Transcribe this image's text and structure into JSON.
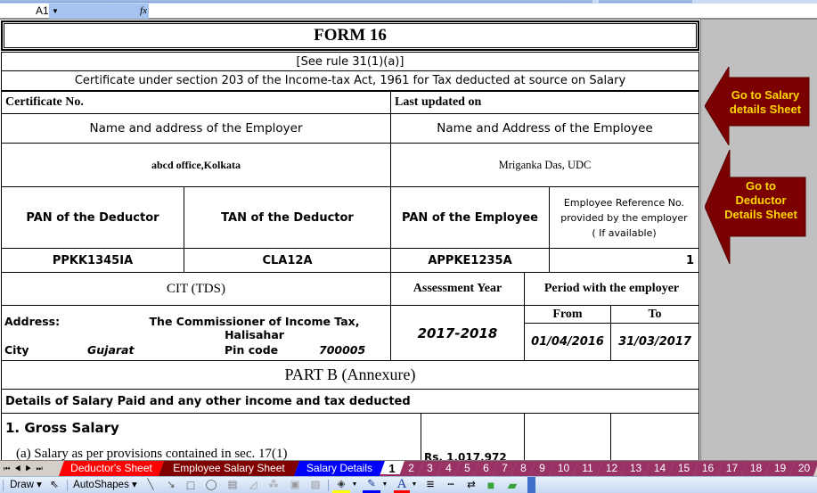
{
  "formula_bar": {
    "name_box": "A1",
    "dropdown_icon": "▼",
    "fx_label": "fx",
    "formula": ""
  },
  "form": {
    "title": "FORM 16",
    "rule": "[See rule 31(1)(a)]",
    "certificate_caption": "Certificate under section 203 of the Income-tax Act, 1961 for Tax deducted at source on Salary",
    "certificate_no_label": "Certificate No.",
    "last_updated_label": "Last updated on",
    "employer_header": "Name and address of the Employer",
    "employee_header": "Name and Address of the Employee",
    "employer_name": "abcd office,Kolkata",
    "employee_name": "Mriganka Das, UDC",
    "pan_deductor_label": "PAN of the Deductor",
    "tan_deductor_label": "TAN of the Deductor",
    "pan_employee_label": "PAN of the Employee",
    "employee_ref_label_1": "Employee Reference No.",
    "employee_ref_label_2": "provided by the employer",
    "employee_ref_label_3": "( If available)",
    "pan_deductor": "PPKK1345IA",
    "tan_deductor": "CLA12A",
    "pan_employee": "APPKE1235A",
    "employee_ref": "1",
    "cit_header": "CIT (TDS)",
    "assessment_year_label": "Assessment Year",
    "period_label": "Period with the employer",
    "address_label": "Address:",
    "address_value": "The Commissioner of Income Tax, Halisahar",
    "city_label": "City",
    "city_value": "Gujarat",
    "pin_label": "Pin code",
    "pin_value": "700005",
    "assessment_year": "2017-2018",
    "from_label": "From",
    "to_label": "To",
    "from_date": "01/04/2016",
    "to_date": "31/03/2017",
    "part_b_title": "PART B (Annexure)",
    "salary_details_caption": "Details of Salary Paid and any other income and tax deducted",
    "gross_salary_label": "1.  Gross Salary",
    "salary_17_1_label": "(a) Salary as per provisions contained in sec. 17(1)",
    "salary_17_1_value": "Rs. 1,017,972"
  },
  "buttons": {
    "salary_sheet": [
      "Go to Salary",
      "details Sheet"
    ],
    "deductor_sheet": [
      "Go to",
      "Deductor",
      "Details  Sheet"
    ],
    "arrow_color": "#7b0000",
    "text_color": "#ffd800"
  },
  "sheet_nav": {
    "first": "⏮",
    "prev": "◀",
    "next": "▶",
    "last": "⏭"
  },
  "tabs": [
    {
      "label": "Deductor's Sheet",
      "color": "#ff0000"
    },
    {
      "label": "Employee Salary Sheet",
      "color": "#800000"
    },
    {
      "label": "Salary Details",
      "color": "#0000ff"
    },
    {
      "label": "1",
      "color": "#ffffff",
      "active": true
    },
    {
      "label": "2",
      "color": "#993366"
    },
    {
      "label": "3",
      "color": "#993366"
    },
    {
      "label": "4",
      "color": "#993366"
    },
    {
      "label": "5",
      "color": "#993366"
    },
    {
      "label": "6",
      "color": "#993366"
    },
    {
      "label": "7",
      "color": "#993366"
    },
    {
      "label": "8",
      "color": "#993366"
    },
    {
      "label": "9",
      "color": "#993366"
    },
    {
      "label": "10",
      "color": "#993366"
    },
    {
      "label": "11",
      "color": "#993366"
    },
    {
      "label": "12",
      "color": "#993366"
    },
    {
      "label": "13",
      "color": "#993366"
    },
    {
      "label": "14",
      "color": "#993366"
    },
    {
      "label": "15",
      "color": "#993366"
    },
    {
      "label": "16",
      "color": "#993366"
    },
    {
      "label": "17",
      "color": "#993366"
    },
    {
      "label": "18",
      "color": "#993366"
    },
    {
      "label": "19",
      "color": "#993366"
    },
    {
      "label": "20",
      "color": "#993366"
    }
  ],
  "draw_toolbar": {
    "draw_label": "Draw ▾",
    "autoshapes_label": "AutoShapes ▾",
    "icons": {
      "select": "⇖",
      "line": "╲",
      "arrow": "↘",
      "rectangle": "□",
      "oval": "◯",
      "textbox": "▤",
      "wordart": "◿",
      "diagram": "⁂",
      "clipart": "▣",
      "picture": "▨",
      "fill": "◈",
      "line_color": "✎",
      "font_color": "A",
      "line_style": "≡",
      "dash_style": "┉",
      "arrow_style": "⇄",
      "shadow": "■",
      "3d": "▰"
    }
  }
}
